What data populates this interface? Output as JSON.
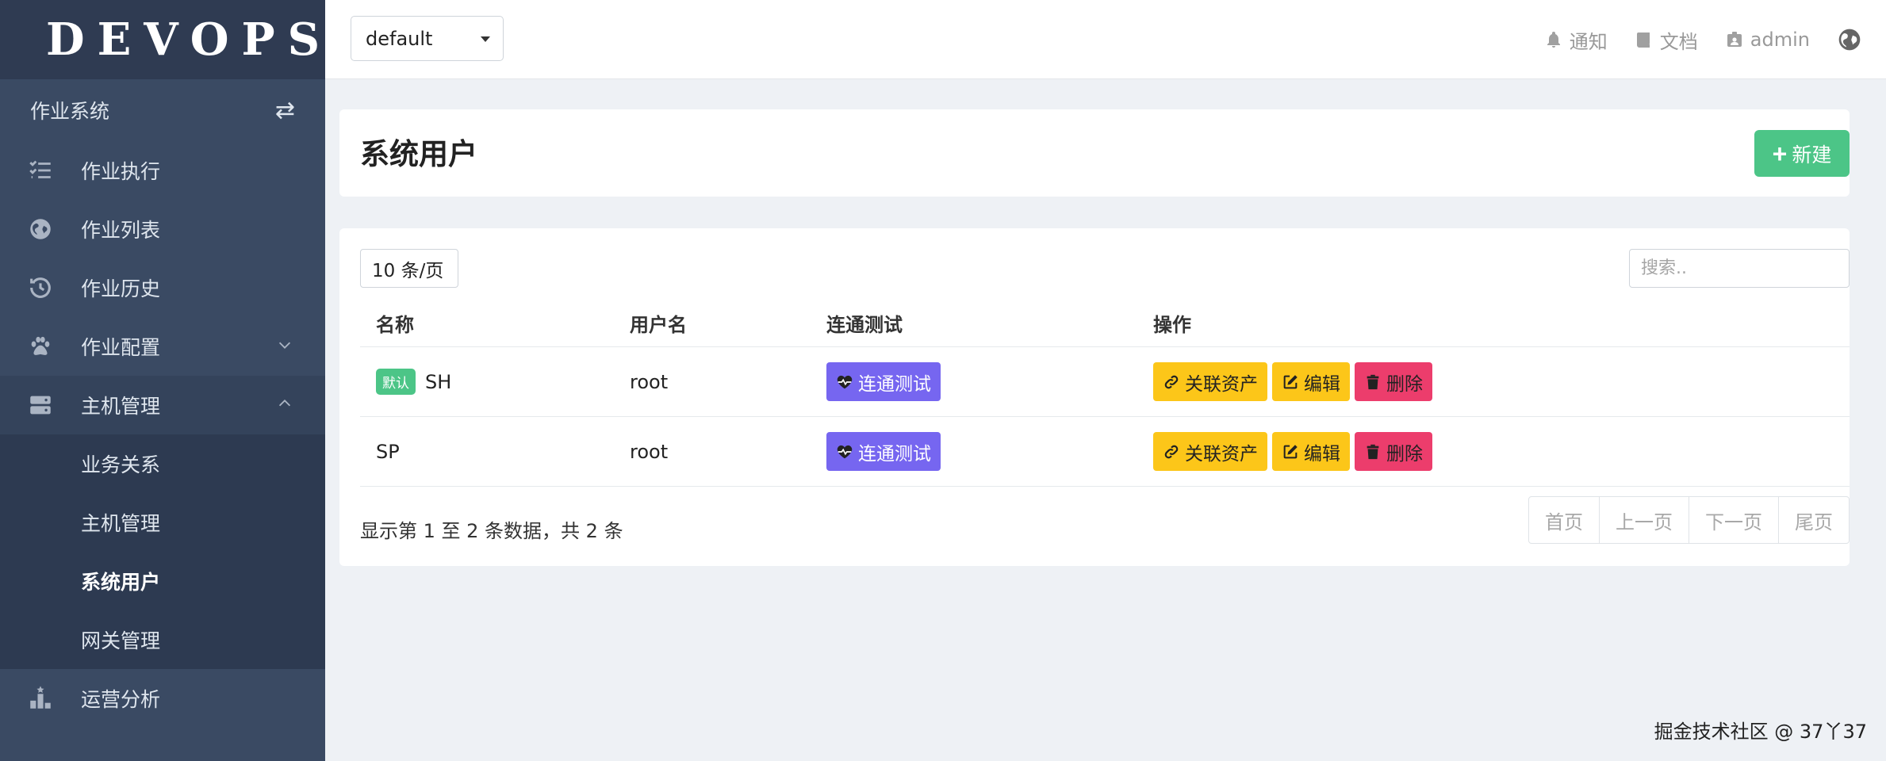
{
  "app": {
    "logo_text": "DEVOPS"
  },
  "sidebar": {
    "system_label": "作业系统",
    "items": [
      {
        "label": "作业执行",
        "icon": "tasks-icon"
      },
      {
        "label": "作业列表",
        "icon": "globe-icon"
      },
      {
        "label": "作业历史",
        "icon": "history-icon"
      },
      {
        "label": "作业配置",
        "icon": "paw-icon"
      },
      {
        "label": "主机管理",
        "icon": "server-icon"
      },
      {
        "label": "运营分析",
        "icon": "chart-icon"
      }
    ],
    "sub_items": [
      {
        "label": "业务关系"
      },
      {
        "label": "主机管理"
      },
      {
        "label": "系统用户"
      },
      {
        "label": "网关管理"
      }
    ]
  },
  "topbar": {
    "project": "default",
    "notify": "通知",
    "docs": "文档",
    "user": "admin"
  },
  "page": {
    "title": "系统用户",
    "new_label": "新建",
    "per_page": "10 条/页",
    "search_placeholder": "搜索.."
  },
  "table": {
    "headers": [
      "名称",
      "用户名",
      "连通测试",
      "操作"
    ],
    "rows": [
      {
        "badge": "默认",
        "name": "SH",
        "username": "root",
        "test": "连通测试",
        "op_link": "关联资产",
        "op_edit": "编辑",
        "op_delete": "删除"
      },
      {
        "name": "SP",
        "username": "root",
        "test": "连通测试",
        "op_link": "关联资产",
        "op_edit": "编辑",
        "op_delete": "删除"
      }
    ],
    "info": "显示第 1 至 2 条数据，共 2 条"
  },
  "pagination": {
    "first": "首页",
    "prev": "上一页",
    "next": "下一页",
    "last": "尾页"
  },
  "credit": "掘金技术社区 @ 37丫37",
  "colors": {
    "sidebar": "#3a4a63",
    "primary": "#4cc587",
    "test": "#7666f0",
    "warning": "#fcc619",
    "danger": "#ec3d6c"
  }
}
